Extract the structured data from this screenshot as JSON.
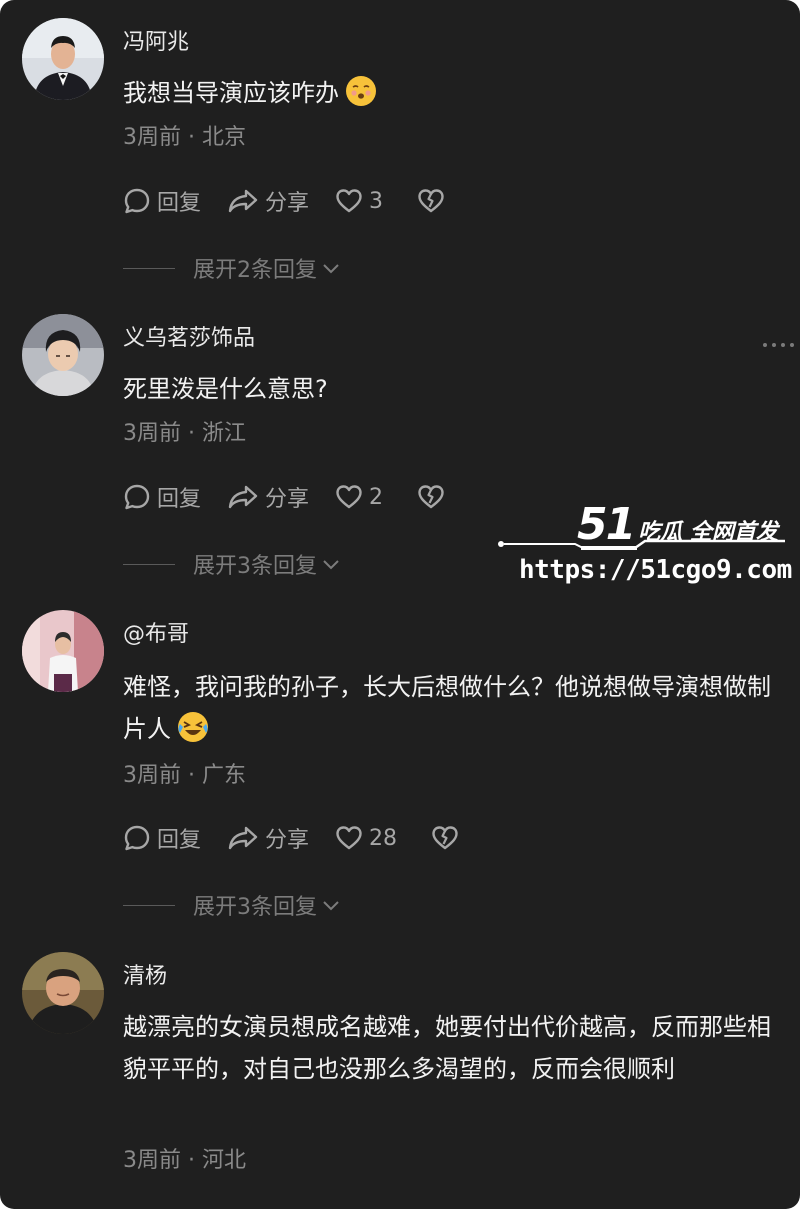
{
  "comments": [
    {
      "username": "冯阿兆",
      "text": "我想当导演应该咋办",
      "emoji": "shushing-face-emoji",
      "meta": "3周前 · 北京",
      "reply_label": "回复",
      "share_label": "分享",
      "likes": "3",
      "expand_label": "展开2条回复"
    },
    {
      "username": "义乌茗莎饰品",
      "text": "死里泼是什么意思?",
      "meta": "3周前 · 浙江",
      "reply_label": "回复",
      "share_label": "分享",
      "likes": "2",
      "expand_label": "展开3条回复"
    },
    {
      "username": "@布哥",
      "text": "难怪，我问我的孙子，长大后想做什么？他说想做导演想做制片人",
      "emoji": "laughing-crying-emoji",
      "meta": "3周前 · 广东",
      "reply_label": "回复",
      "share_label": "分享",
      "likes": "28",
      "expand_label": "展开3条回复"
    },
    {
      "username": "清杨",
      "text": "越漂亮的女演员想成名越难，她要付出代价越高，反而那些相貌平平的，对自己也没那么多渴望的，反而会很顺利",
      "meta": "3周前 · 河北"
    }
  ],
  "watermark": {
    "number": "51",
    "tag": "吃瓜 全网首发",
    "url": "https://51cgo9.com"
  }
}
